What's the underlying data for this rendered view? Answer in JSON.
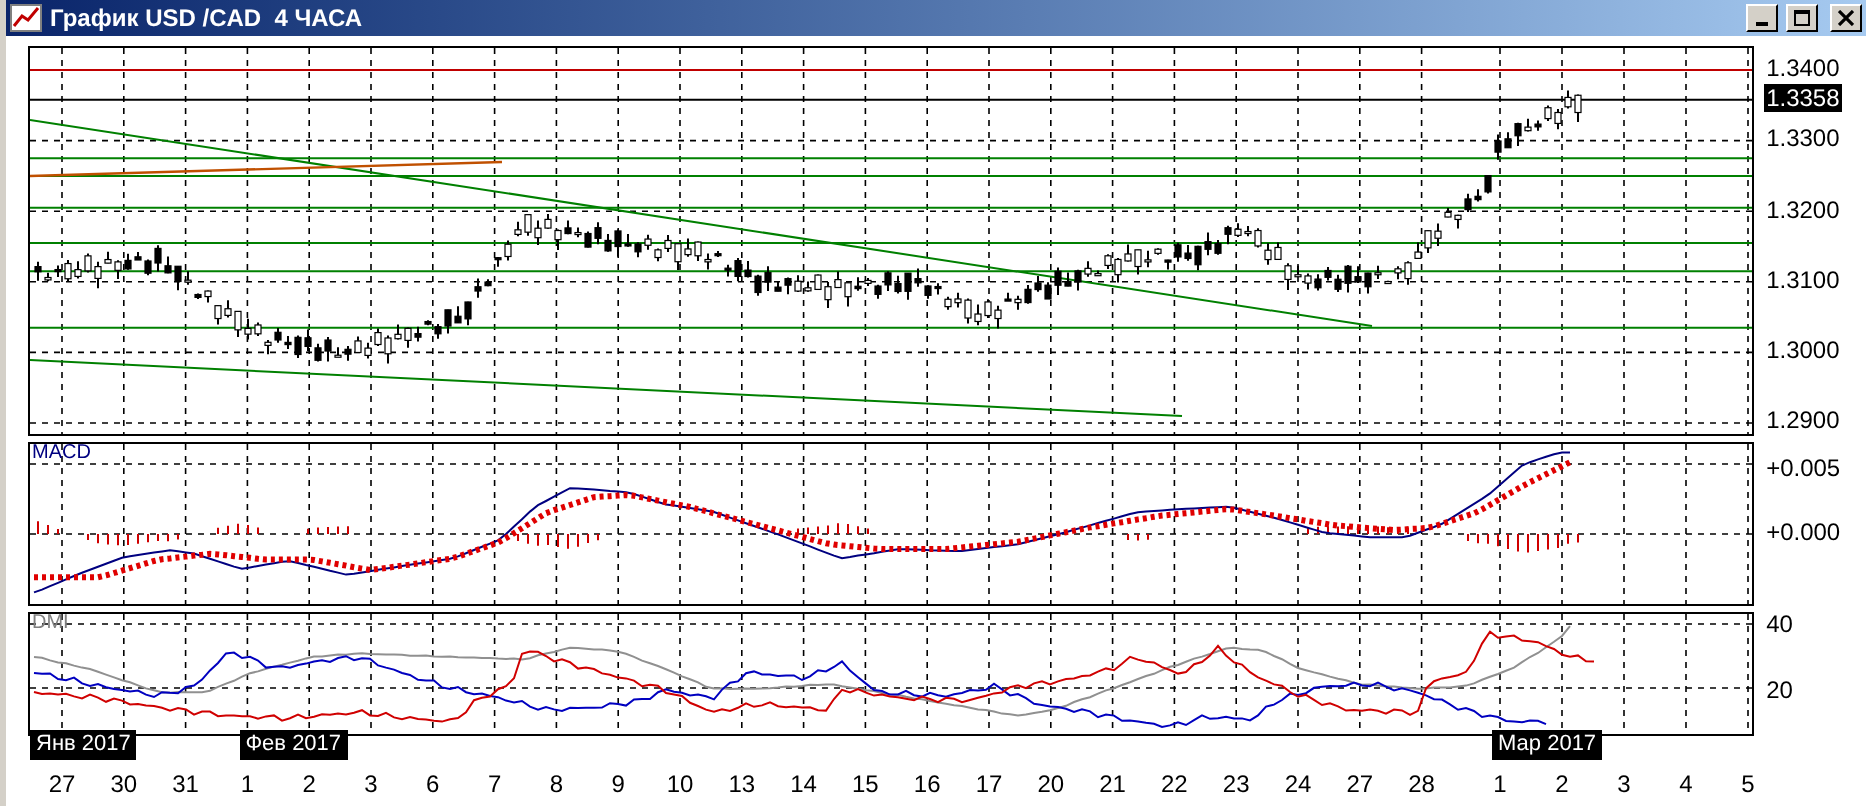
{
  "window": {
    "title": "График USD /CAD  4 ЧАСА"
  },
  "price_panel": {
    "axis": [
      "1.3400",
      "1.3300",
      "1.3200",
      "1.3100",
      "1.3000",
      "1.2900"
    ],
    "current_price": "1.3358"
  },
  "macd_panel": {
    "label": "MACD",
    "axis": [
      "+0.005",
      "+0.000"
    ]
  },
  "dmi_panel": {
    "label": "DMI",
    "axis": [
      "40",
      "20"
    ]
  },
  "date_axis": [
    {
      "day": "27",
      "month": "Янв 2017"
    },
    {
      "day": "30"
    },
    {
      "day": "31"
    },
    {
      "day": "1",
      "month": "Фев 2017"
    },
    {
      "day": "2"
    },
    {
      "day": "3"
    },
    {
      "day": "6"
    },
    {
      "day": "7"
    },
    {
      "day": "8"
    },
    {
      "day": "9"
    },
    {
      "day": "10"
    },
    {
      "day": "13"
    },
    {
      "day": "14"
    },
    {
      "day": "15"
    },
    {
      "day": "16"
    },
    {
      "day": "17"
    },
    {
      "day": "20"
    },
    {
      "day": "21"
    },
    {
      "day": "22"
    },
    {
      "day": "23"
    },
    {
      "day": "24"
    },
    {
      "day": "27"
    },
    {
      "day": "28"
    },
    {
      "day": "1",
      "month": "Мар 2017"
    },
    {
      "day": "2"
    },
    {
      "day": "3"
    },
    {
      "day": "4"
    },
    {
      "day": "5"
    }
  ]
}
